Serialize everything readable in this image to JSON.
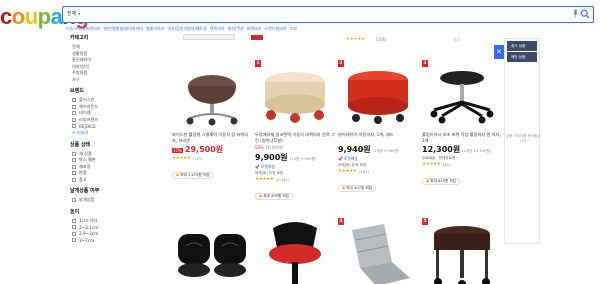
{
  "logo": {
    "letters": [
      "c",
      "o",
      "u",
      "p",
      "a",
      "n",
      "g"
    ],
    "colors": [
      "#ae1b1e",
      "#ef8b1f",
      "#f4c20d",
      "#7fb539",
      "#29a8e0",
      "#2363b5",
      "#e23b2e"
    ]
  },
  "search": {
    "category": "전체",
    "query": "",
    "related": [
      "이동식의자/바퀴의자",
      "발판/발받침대/의자커버",
      "발물이의자",
      "의자/등받이방석/매트용",
      "목욕의자",
      "방석/쿠션",
      "바퀴의자",
      "스텐드형의자",
      "소파"
    ]
  },
  "sidebar": {
    "categories": {
      "title": "카테고리",
      "items": [
        "전체",
        "생활용품",
        "홈인테리어",
        "의자/방석",
        "주방용품",
        "가구"
      ]
    },
    "brand": {
      "title": "브랜드",
      "items": [
        "플리스빈",
        "체어라운드",
        "데이엔",
        "리빙프렌즈",
        "REJOICE"
      ],
      "more": "+ 더보기"
    },
    "condition": {
      "title": "상품 상태",
      "items": [
        "새 상품",
        "박스 훼손",
        "재포장",
        "반품",
        "중고"
      ]
    },
    "delivery": {
      "title": "날개상품 여부",
      "items": [
        "날개상품"
      ]
    },
    "height": {
      "title": "높이",
      "items": [
        "1cm 이하",
        "2~3.1cm",
        "2.9~3cm",
        "3~7cm"
      ]
    }
  },
  "top_strip": {
    "stars": "★★★★★",
    "count": "(336)",
    "note": "광고"
  },
  "products": [
    {
      "rank": "",
      "name": "와이드한 롤링형 스윙체어 이동식 장 바퀴의자, 브라운",
      "orig": "",
      "discount": "",
      "price": "29,500원",
      "price_red": true,
      "coupon": "17%",
      "unit": "",
      "rocket": "",
      "delivery": "",
      "stars": "★★★★★",
      "rating_count": "(125)",
      "cashback": "최대 1,475원 적립"
    },
    {
      "rank": "1",
      "name": "두랑에이체 일코렌택 이동식 바퀴의자 원목 그린 (원목나무발)",
      "orig": "16,900원",
      "discount": "58%",
      "price": "9,900원",
      "price_red": false,
      "coupon": "",
      "unit": "(1개당 9,900원)",
      "rocket": "로켓배송",
      "delivery": "모레(토) 도착 보장",
      "stars": "★★★★★",
      "rating_count": "(3,441)",
      "cashback": "최대 495원 적립"
    },
    {
      "rank": "2",
      "name": "위어데이어 이동의자, 1개, 레드",
      "orig": "",
      "discount": "",
      "price": "9,940원",
      "price_red": false,
      "coupon": "",
      "unit": "(1개당 9,940원)",
      "rocket": "로켓배송",
      "delivery": "모레(토) 도착 보장",
      "stars": "★★★★★",
      "rating_count": "(582)",
      "cashback": "최대 497원 적립"
    },
    {
      "rank": "3",
      "name": "롤링이어시 보조 바퀴 작업 롤링의자 원 의자, 1개",
      "orig": "",
      "discount": "",
      "price": "12,300원",
      "price_red": false,
      "coupon": "",
      "unit": "(1개당 12,300원)",
      "rocket": "",
      "delivery": "무료배송 · 판매자로켓",
      "stars": "★★★★★",
      "rating_count": "(41)",
      "cashback": "최대 615원 적립"
    }
  ],
  "row2_ranks": [
    "",
    "",
    "4",
    "5"
  ],
  "right_ad": {
    "b1": "광고 상품",
    "b2": "제안 상품",
    "mid": "상품 이미지를 준비중입니다"
  },
  "pager": "1 / 2"
}
